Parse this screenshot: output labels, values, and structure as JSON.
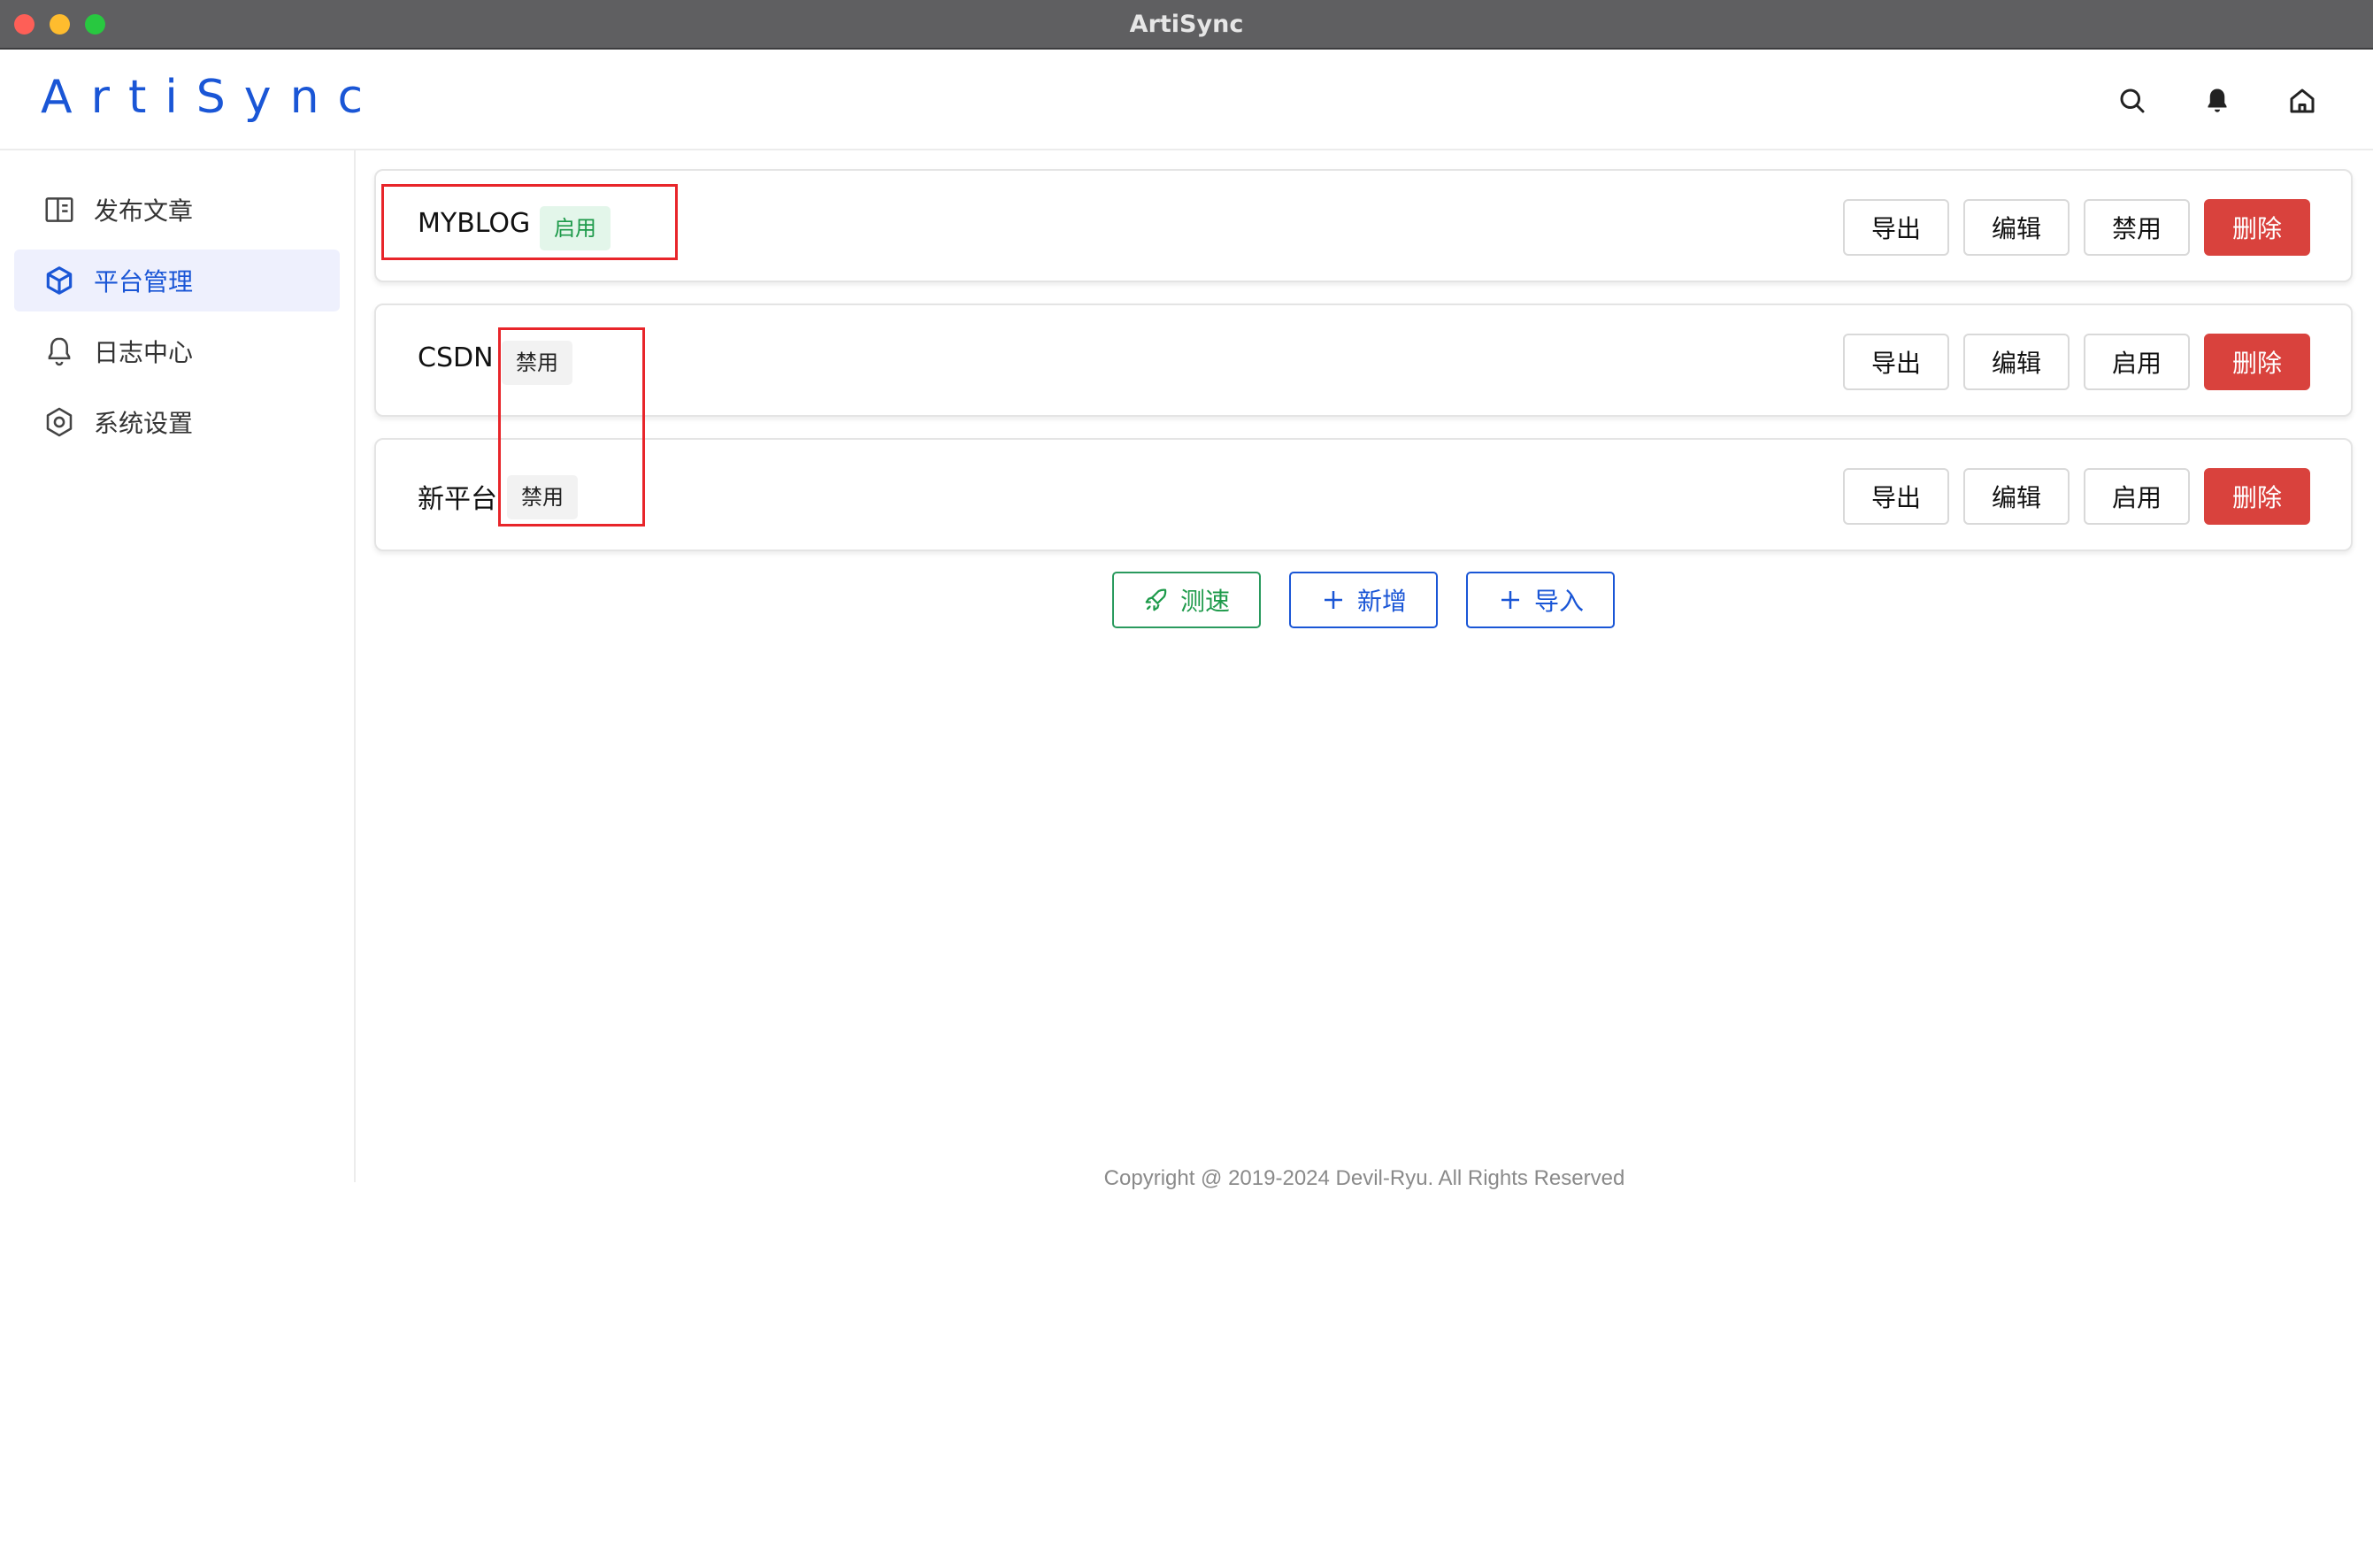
{
  "window": {
    "title": "ArtiSync"
  },
  "header": {
    "logo": "ArtiSync",
    "icons": [
      "search-icon",
      "bell-icon",
      "home-icon"
    ]
  },
  "sidebar": {
    "items": [
      {
        "label": "发布文章",
        "icon": "book-icon",
        "active": false
      },
      {
        "label": "平台管理",
        "icon": "cube-icon",
        "active": true
      },
      {
        "label": "日志中心",
        "icon": "bell-outline-icon",
        "active": false
      },
      {
        "label": "系统设置",
        "icon": "hexagon-gear-icon",
        "active": false
      }
    ]
  },
  "platforms": [
    {
      "name": "MYBLOG",
      "status": "启用",
      "actions": [
        "导出",
        "编辑",
        "禁用",
        "删除"
      ]
    },
    {
      "name": "CSDN",
      "status": "禁用",
      "actions": [
        "导出",
        "编辑",
        "启用",
        "删除"
      ]
    },
    {
      "name": "新平台",
      "status": "禁用",
      "actions": [
        "导出",
        "编辑",
        "启用",
        "删除"
      ]
    }
  ],
  "bottom_actions": {
    "speedtest": "测速",
    "add": "新增",
    "import": "导入"
  },
  "footer": {
    "copyright": "Copyright @ 2019-2024 Devil-Ryu. All Rights Reserved"
  },
  "colors": {
    "primary": "#1a56d6",
    "danger": "#d9423d",
    "success": "#1d9a4a",
    "highlight": "#e8252a"
  }
}
